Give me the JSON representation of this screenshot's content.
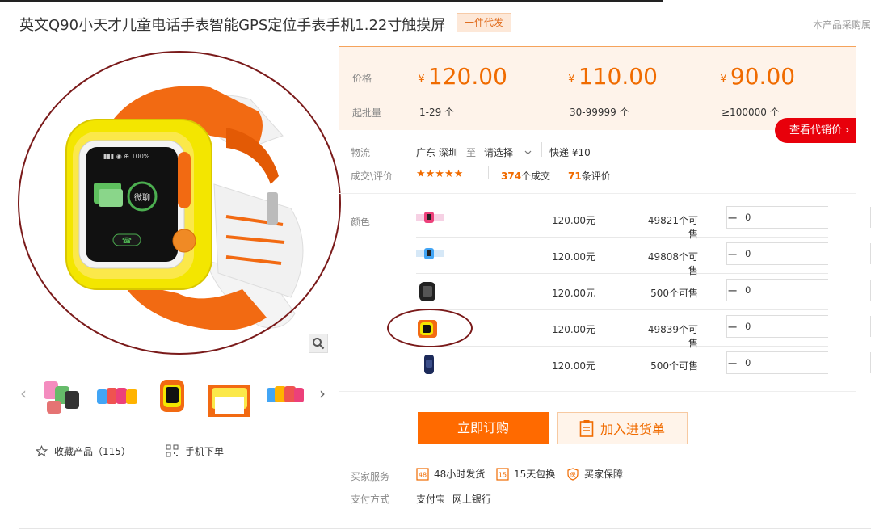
{
  "product": {
    "title": "英文Q90小天才儿童电话手表智能GPS定位手表手机1.22寸触摸屏",
    "dropship_badge": "一件代发",
    "right_notice": "本产品采购属"
  },
  "gallery": {
    "watch_screen_text": "微聊",
    "zoom_icon": "magnifier-icon",
    "thumbnail_count": 5
  },
  "actions": {
    "favorite_label": "收藏产品（115）",
    "mobile_order_label": "手机下单"
  },
  "pricing": {
    "price_label": "价格",
    "moq_label": "起批量",
    "currency_symbol": "¥",
    "tiers": [
      {
        "price": "120.00",
        "quantity": "1-29 个"
      },
      {
        "price": "110.00",
        "quantity": "30-99999 个"
      },
      {
        "price": "90.00",
        "quantity": "≥100000 个"
      }
    ],
    "agent_price_button": "查看代销价 ›"
  },
  "logistics": {
    "label": "物流",
    "origin": "广东 深圳",
    "to_word": "至",
    "destination_placeholder": "请选择",
    "shipping": "快递 ¥10"
  },
  "reviews": {
    "label": "成交\\评价",
    "rating": 4.5,
    "stars_text": "★★★★★",
    "deals_count": "374",
    "deals_suffix": "个成交",
    "review_count": "71",
    "review_suffix": "条评价"
  },
  "variants": {
    "label": "颜色",
    "rows": [
      {
        "price": "120.00元",
        "stock": "49821个可售",
        "qty": "0",
        "swatch": "pink"
      },
      {
        "price": "120.00元",
        "stock": "49808个可售",
        "qty": "0",
        "swatch": "blue"
      },
      {
        "price": "120.00元",
        "stock": "500个可售",
        "qty": "0",
        "swatch": "black"
      },
      {
        "price": "120.00元",
        "stock": "49839个可售",
        "qty": "0",
        "swatch": "yellow-orange"
      },
      {
        "price": "120.00元",
        "stock": "500个可售",
        "qty": "0",
        "swatch": "navy"
      }
    ]
  },
  "buttons": {
    "order_now": "立即订购",
    "add_to_cart": "加入进货单"
  },
  "services": {
    "buyer_label": "买家服务",
    "items": [
      {
        "icon_text": "48",
        "label": "48小时发货"
      },
      {
        "icon_text": "15",
        "label": "15天包换"
      },
      {
        "icon_text": "保",
        "label": "买家保障"
      }
    ],
    "payment_label": "支付方式",
    "payment_methods": [
      "支付宝",
      "网上银行"
    ]
  },
  "colors": {
    "accent": "#ff6a00",
    "price": "#f06b00",
    "agent_red": "#e8000b",
    "circle": "#7a1a1a"
  }
}
